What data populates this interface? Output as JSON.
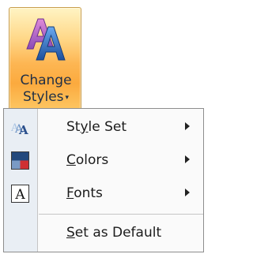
{
  "button": {
    "label_line1": "Change",
    "label_line2": "Styles",
    "caret": "▾",
    "icon": "change-styles-icon"
  },
  "menu": {
    "items": [
      {
        "pre": "St",
        "access": "y",
        "post": "le Set",
        "icon": "style-set-icon",
        "submenu": true
      },
      {
        "pre": "",
        "access": "C",
        "post": "olors",
        "icon": "colors-icon",
        "submenu": true
      },
      {
        "pre": "",
        "access": "F",
        "post": "onts",
        "icon": "fonts-icon",
        "submenu": true
      },
      {
        "pre": "",
        "access": "S",
        "post": "et as Default",
        "icon": "",
        "submenu": false
      }
    ],
    "fonts_icon_glyph": "A"
  },
  "colors": {
    "accent_orange": "#fbaa3e",
    "menu_gutter": "#e9eef4",
    "text": "#1b1b1b"
  }
}
